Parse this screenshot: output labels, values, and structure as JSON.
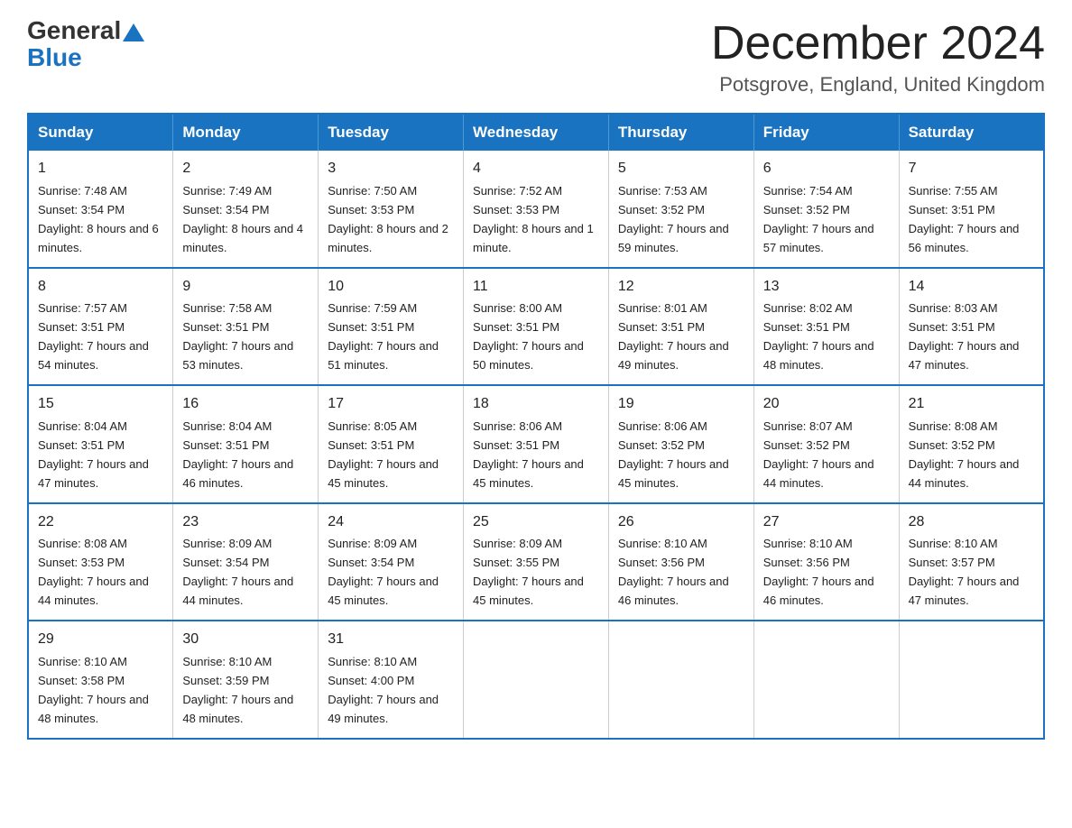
{
  "header": {
    "logo_general": "General",
    "logo_blue": "Blue",
    "month_title": "December 2024",
    "location": "Potsgrove, England, United Kingdom"
  },
  "days_of_week": [
    "Sunday",
    "Monday",
    "Tuesday",
    "Wednesday",
    "Thursday",
    "Friday",
    "Saturday"
  ],
  "weeks": [
    [
      {
        "day": "1",
        "sunrise": "7:48 AM",
        "sunset": "3:54 PM",
        "daylight": "8 hours and 6 minutes."
      },
      {
        "day": "2",
        "sunrise": "7:49 AM",
        "sunset": "3:54 PM",
        "daylight": "8 hours and 4 minutes."
      },
      {
        "day": "3",
        "sunrise": "7:50 AM",
        "sunset": "3:53 PM",
        "daylight": "8 hours and 2 minutes."
      },
      {
        "day": "4",
        "sunrise": "7:52 AM",
        "sunset": "3:53 PM",
        "daylight": "8 hours and 1 minute."
      },
      {
        "day": "5",
        "sunrise": "7:53 AM",
        "sunset": "3:52 PM",
        "daylight": "7 hours and 59 minutes."
      },
      {
        "day": "6",
        "sunrise": "7:54 AM",
        "sunset": "3:52 PM",
        "daylight": "7 hours and 57 minutes."
      },
      {
        "day": "7",
        "sunrise": "7:55 AM",
        "sunset": "3:51 PM",
        "daylight": "7 hours and 56 minutes."
      }
    ],
    [
      {
        "day": "8",
        "sunrise": "7:57 AM",
        "sunset": "3:51 PM",
        "daylight": "7 hours and 54 minutes."
      },
      {
        "day": "9",
        "sunrise": "7:58 AM",
        "sunset": "3:51 PM",
        "daylight": "7 hours and 53 minutes."
      },
      {
        "day": "10",
        "sunrise": "7:59 AM",
        "sunset": "3:51 PM",
        "daylight": "7 hours and 51 minutes."
      },
      {
        "day": "11",
        "sunrise": "8:00 AM",
        "sunset": "3:51 PM",
        "daylight": "7 hours and 50 minutes."
      },
      {
        "day": "12",
        "sunrise": "8:01 AM",
        "sunset": "3:51 PM",
        "daylight": "7 hours and 49 minutes."
      },
      {
        "day": "13",
        "sunrise": "8:02 AM",
        "sunset": "3:51 PM",
        "daylight": "7 hours and 48 minutes."
      },
      {
        "day": "14",
        "sunrise": "8:03 AM",
        "sunset": "3:51 PM",
        "daylight": "7 hours and 47 minutes."
      }
    ],
    [
      {
        "day": "15",
        "sunrise": "8:04 AM",
        "sunset": "3:51 PM",
        "daylight": "7 hours and 47 minutes."
      },
      {
        "day": "16",
        "sunrise": "8:04 AM",
        "sunset": "3:51 PM",
        "daylight": "7 hours and 46 minutes."
      },
      {
        "day": "17",
        "sunrise": "8:05 AM",
        "sunset": "3:51 PM",
        "daylight": "7 hours and 45 minutes."
      },
      {
        "day": "18",
        "sunrise": "8:06 AM",
        "sunset": "3:51 PM",
        "daylight": "7 hours and 45 minutes."
      },
      {
        "day": "19",
        "sunrise": "8:06 AM",
        "sunset": "3:52 PM",
        "daylight": "7 hours and 45 minutes."
      },
      {
        "day": "20",
        "sunrise": "8:07 AM",
        "sunset": "3:52 PM",
        "daylight": "7 hours and 44 minutes."
      },
      {
        "day": "21",
        "sunrise": "8:08 AM",
        "sunset": "3:52 PM",
        "daylight": "7 hours and 44 minutes."
      }
    ],
    [
      {
        "day": "22",
        "sunrise": "8:08 AM",
        "sunset": "3:53 PM",
        "daylight": "7 hours and 44 minutes."
      },
      {
        "day": "23",
        "sunrise": "8:09 AM",
        "sunset": "3:54 PM",
        "daylight": "7 hours and 44 minutes."
      },
      {
        "day": "24",
        "sunrise": "8:09 AM",
        "sunset": "3:54 PM",
        "daylight": "7 hours and 45 minutes."
      },
      {
        "day": "25",
        "sunrise": "8:09 AM",
        "sunset": "3:55 PM",
        "daylight": "7 hours and 45 minutes."
      },
      {
        "day": "26",
        "sunrise": "8:10 AM",
        "sunset": "3:56 PM",
        "daylight": "7 hours and 46 minutes."
      },
      {
        "day": "27",
        "sunrise": "8:10 AM",
        "sunset": "3:56 PM",
        "daylight": "7 hours and 46 minutes."
      },
      {
        "day": "28",
        "sunrise": "8:10 AM",
        "sunset": "3:57 PM",
        "daylight": "7 hours and 47 minutes."
      }
    ],
    [
      {
        "day": "29",
        "sunrise": "8:10 AM",
        "sunset": "3:58 PM",
        "daylight": "7 hours and 48 minutes."
      },
      {
        "day": "30",
        "sunrise": "8:10 AM",
        "sunset": "3:59 PM",
        "daylight": "7 hours and 48 minutes."
      },
      {
        "day": "31",
        "sunrise": "8:10 AM",
        "sunset": "4:00 PM",
        "daylight": "7 hours and 49 minutes."
      },
      null,
      null,
      null,
      null
    ]
  ]
}
